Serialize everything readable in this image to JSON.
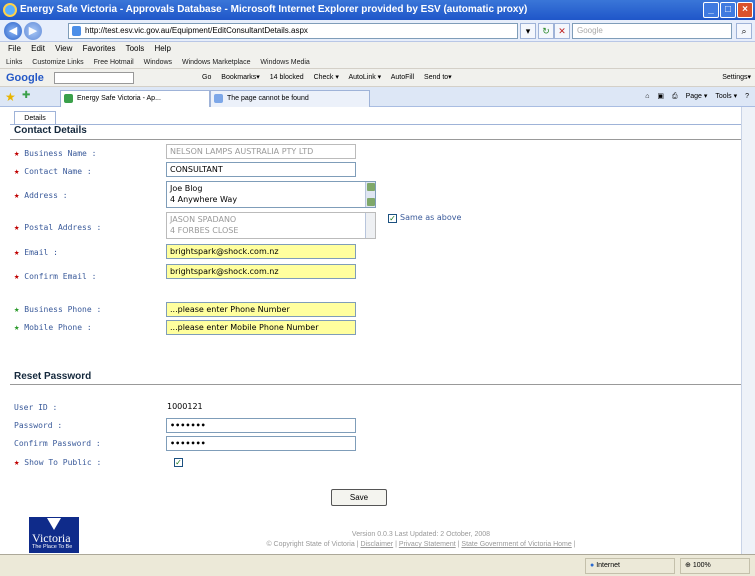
{
  "window": {
    "title": "Energy Safe Victoria - Approvals Database - Microsoft Internet Explorer provided by ESV (automatic proxy)",
    "minimize": "_",
    "maximize": "□",
    "close": "×"
  },
  "address": {
    "url": "http://test.esv.vic.gov.au/Equipment/EditConsultantDetails.aspx",
    "search_placeholder": "Google"
  },
  "menu": [
    "File",
    "Edit",
    "View",
    "Favorites",
    "Tools",
    "Help"
  ],
  "links": [
    "Links",
    "Customize Links",
    "Free Hotmail",
    "Windows",
    "Windows Marketplace",
    "Windows Media"
  ],
  "google_toolbar": {
    "logo": "Google",
    "items": [
      "Go",
      "Bookmarks▾",
      "14 blocked",
      "Check ▾",
      "AutoLink ▾",
      "AutoFill",
      "Send to▾"
    ],
    "settings": "Settings▾"
  },
  "tabs": [
    {
      "label": "Energy Safe Victoria - Ap...",
      "active": true
    },
    {
      "label": "The page cannot be found",
      "active": false
    }
  ],
  "tab_tools": [
    "Page ▾",
    "Tools ▾"
  ],
  "page": {
    "tab_label": "Details",
    "contact_heading": "Contact Details",
    "business_name_label": "Business Name :",
    "business_name_value": "NELSON LAMPS AUSTRALIA PTY LTD",
    "contact_name_label": "Contact Name :",
    "contact_name_value": "CONSULTANT",
    "address_label": "Address :",
    "address_line1": "Joe Blog",
    "address_line2": "4 Anywhere Way",
    "postal_label": "Postal Address :",
    "postal_line1": "JASON SPADANO",
    "postal_line2": "4 FORBES CLOSE",
    "same_as_above": "Same as above",
    "email_label": "Email :",
    "email_value": "brightspark@shock.com.nz",
    "confirm_email_label": "Confirm Email :",
    "confirm_email_value": "brightspark@shock.com.nz",
    "business_phone_label": "Business Phone :",
    "business_phone_placeholder": "...please enter Phone Number",
    "mobile_phone_label": "Mobile Phone :",
    "mobile_phone_placeholder": "...please enter Mobile Phone Number",
    "reset_heading": "Reset Password",
    "user_id_label": "User ID :",
    "user_id_value": "1000121",
    "password_label": "Password :",
    "password_value": "•••••••",
    "confirm_password_label": "Confirm Password :",
    "confirm_password_value": "•••••••",
    "show_public_label": "Show To Public :",
    "save_label": "Save"
  },
  "logo": {
    "text": "Victoria",
    "tagline": "The Place To Be"
  },
  "footer": {
    "version": "Version 0.0.3  Last Updated: 2 October, 2008",
    "copyright": "© Copyright State of Victoria |",
    "disclaimer": "Disclaimer",
    "sep1": "|",
    "privacy": "Privacy Statement",
    "sep2": "|",
    "home": "State Government of Victoria Home",
    "sep3": "|"
  },
  "status": {
    "zone": "Internet",
    "zoom": "100%"
  }
}
